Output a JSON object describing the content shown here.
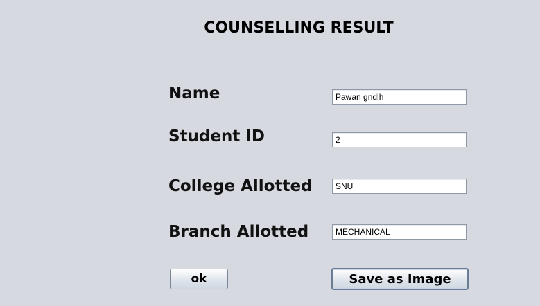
{
  "window": {
    "title": "COUNSELLING RESULT"
  },
  "form": {
    "name_label": "Name",
    "name_value": "Pawan gndlh",
    "student_id_label": "Student ID",
    "student_id_value": "2",
    "college_label": "College Allotted",
    "college_value": "SNU",
    "branch_label": "Branch Allotted",
    "branch_value": "MECHANICAL"
  },
  "buttons": {
    "ok_label": "ok",
    "save_label": "Save as Image"
  }
}
